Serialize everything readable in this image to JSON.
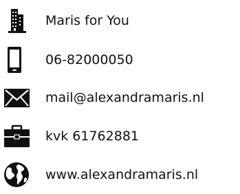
{
  "contacts": {
    "company": {
      "label": "Maris for You",
      "icon": "building-icon"
    },
    "phone": {
      "label": "06-82000050",
      "icon": "mobile-phone-icon"
    },
    "email": {
      "label": "mail@alexandramaris.nl",
      "icon": "envelope-icon"
    },
    "kvk": {
      "label": "kvk 61762881",
      "icon": "briefcase-icon"
    },
    "website": {
      "label": "www.alexandramaris.nl",
      "icon": "globe-icon"
    }
  },
  "colors": {
    "icon": "#111111",
    "text": "#111111",
    "background": "#ffffff"
  }
}
